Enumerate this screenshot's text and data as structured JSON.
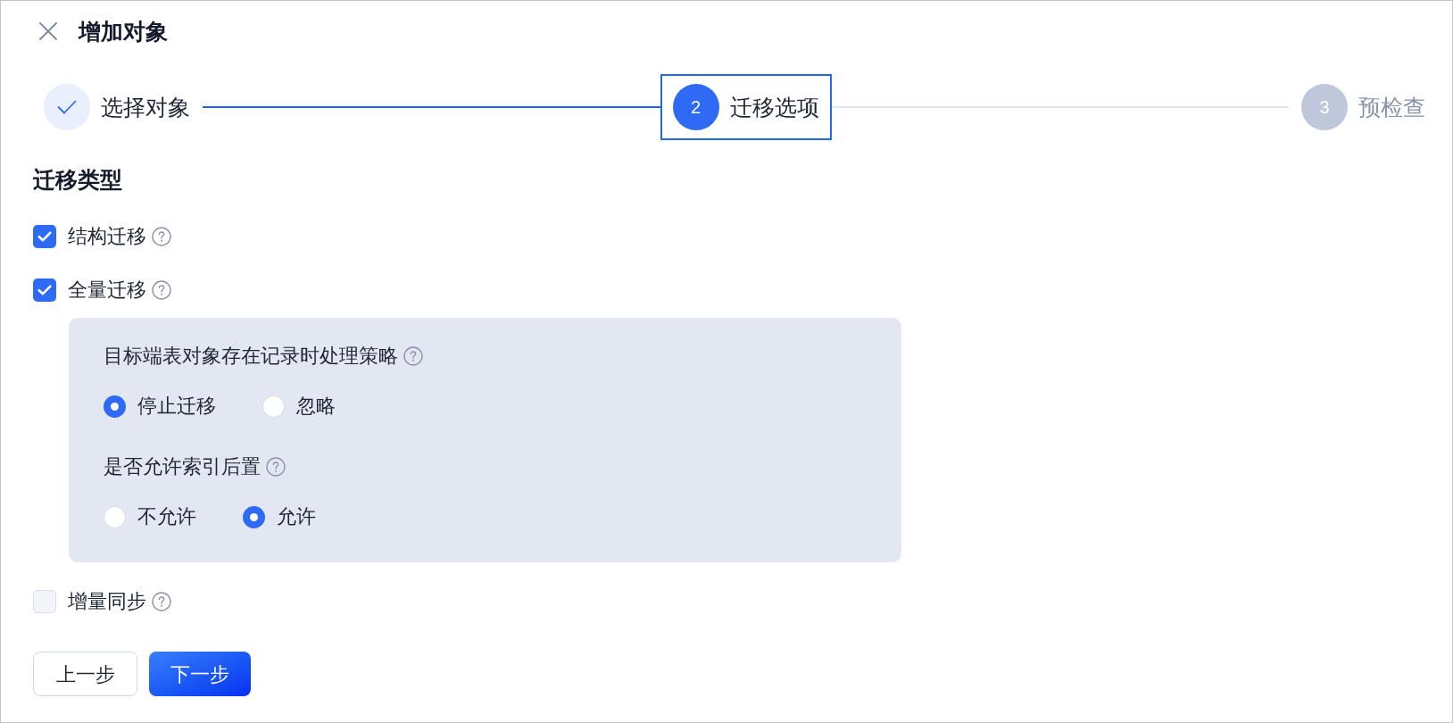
{
  "dialog": {
    "title": "增加对象"
  },
  "steps": [
    {
      "label": "选择对象",
      "completed": true,
      "selected": false
    },
    {
      "number": "2",
      "label": "迁移选项",
      "completed": false,
      "selected": true
    },
    {
      "number": "3",
      "label": "预检查",
      "completed": false,
      "selected": false
    }
  ],
  "migration_types": {
    "title": "迁移类型",
    "options": [
      {
        "label": "结构迁移",
        "checked": true
      },
      {
        "label": "全量迁移",
        "checked": true,
        "settings": [
          {
            "label": "目标端表对象存在记录时处理策略",
            "options": [
              {
                "label": "停止迁移",
                "selected": true
              },
              {
                "label": "忽略",
                "selected": false
              }
            ]
          },
          {
            "label": "是否允许索引后置",
            "options": [
              {
                "label": "不允许",
                "selected": false
              },
              {
                "label": "允许",
                "selected": true
              }
            ]
          }
        ]
      },
      {
        "label": "增量同步",
        "checked": false
      }
    ]
  },
  "buttons": [
    {
      "label": "上一步",
      "kind": "secondary"
    },
    {
      "label": "下一步",
      "kind": "primary"
    }
  ]
}
